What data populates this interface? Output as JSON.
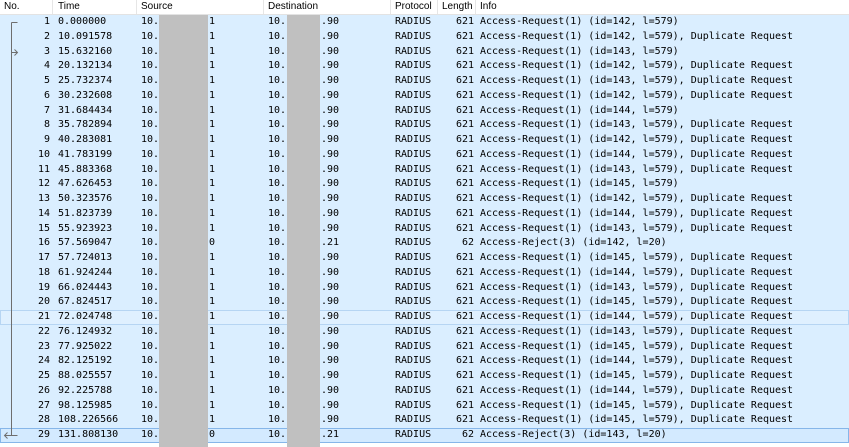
{
  "columns": {
    "no": "No.",
    "time": "Time",
    "source": "Source",
    "destination": "Destination",
    "protocol": "Protocol",
    "length": "Length",
    "info": "Info"
  },
  "colors": {
    "row_background": "#daeeff",
    "redaction": "#c0c0c0"
  },
  "packets": [
    {
      "no": 1,
      "time": "0.000000",
      "source_start": "10.",
      "source_end": "1",
      "destination_start": "10.",
      "destination_end": ".90",
      "protocol": "RADIUS",
      "length": 621,
      "info": "Access-Request(1) (id=142, l=579)",
      "marker": "conversation-start-icon"
    },
    {
      "no": 2,
      "time": "10.091578",
      "source_start": "10.",
      "source_end": "1",
      "destination_start": "10.",
      "destination_end": ".90",
      "protocol": "RADIUS",
      "length": 621,
      "info": "Access-Request(1) (id=142, l=579), Duplicate Request"
    },
    {
      "no": 3,
      "time": "15.632160",
      "source_start": "10.",
      "source_end": "1",
      "destination_start": "10.",
      "destination_end": ".90",
      "protocol": "RADIUS",
      "length": 621,
      "info": "Access-Request(1) (id=143, l=579)",
      "marker": "request-arrow-icon"
    },
    {
      "no": 4,
      "time": "20.132134",
      "source_start": "10.",
      "source_end": "1",
      "destination_start": "10.",
      "destination_end": ".90",
      "protocol": "RADIUS",
      "length": 621,
      "info": "Access-Request(1) (id=142, l=579), Duplicate Request"
    },
    {
      "no": 5,
      "time": "25.732374",
      "source_start": "10.",
      "source_end": "1",
      "destination_start": "10.",
      "destination_end": ".90",
      "protocol": "RADIUS",
      "length": 621,
      "info": "Access-Request(1) (id=143, l=579), Duplicate Request"
    },
    {
      "no": 6,
      "time": "30.232608",
      "source_start": "10.",
      "source_end": "1",
      "destination_start": "10.",
      "destination_end": ".90",
      "protocol": "RADIUS",
      "length": 621,
      "info": "Access-Request(1) (id=142, l=579), Duplicate Request"
    },
    {
      "no": 7,
      "time": "31.684434",
      "source_start": "10.",
      "source_end": "1",
      "destination_start": "10.",
      "destination_end": ".90",
      "protocol": "RADIUS",
      "length": 621,
      "info": "Access-Request(1) (id=144, l=579)"
    },
    {
      "no": 8,
      "time": "35.782894",
      "source_start": "10.",
      "source_end": "1",
      "destination_start": "10.",
      "destination_end": ".90",
      "protocol": "RADIUS",
      "length": 621,
      "info": "Access-Request(1) (id=143, l=579), Duplicate Request"
    },
    {
      "no": 9,
      "time": "40.283081",
      "source_start": "10.",
      "source_end": "1",
      "destination_start": "10.",
      "destination_end": ".90",
      "protocol": "RADIUS",
      "length": 621,
      "info": "Access-Request(1) (id=142, l=579), Duplicate Request"
    },
    {
      "no": 10,
      "time": "41.783199",
      "source_start": "10.",
      "source_end": "1",
      "destination_start": "10.",
      "destination_end": ".90",
      "protocol": "RADIUS",
      "length": 621,
      "info": "Access-Request(1) (id=144, l=579), Duplicate Request"
    },
    {
      "no": 11,
      "time": "45.883368",
      "source_start": "10.",
      "source_end": "1",
      "destination_start": "10.",
      "destination_end": ".90",
      "protocol": "RADIUS",
      "length": 621,
      "info": "Access-Request(1) (id=143, l=579), Duplicate Request"
    },
    {
      "no": 12,
      "time": "47.626453",
      "source_start": "10.",
      "source_end": "1",
      "destination_start": "10.",
      "destination_end": ".90",
      "protocol": "RADIUS",
      "length": 621,
      "info": "Access-Request(1) (id=145, l=579)"
    },
    {
      "no": 13,
      "time": "50.323576",
      "source_start": "10.",
      "source_end": "1",
      "destination_start": "10.",
      "destination_end": ".90",
      "protocol": "RADIUS",
      "length": 621,
      "info": "Access-Request(1) (id=142, l=579), Duplicate Request"
    },
    {
      "no": 14,
      "time": "51.823739",
      "source_start": "10.",
      "source_end": "1",
      "destination_start": "10.",
      "destination_end": ".90",
      "protocol": "RADIUS",
      "length": 621,
      "info": "Access-Request(1) (id=144, l=579), Duplicate Request"
    },
    {
      "no": 15,
      "time": "55.923923",
      "source_start": "10.",
      "source_end": "1",
      "destination_start": "10.",
      "destination_end": ".90",
      "protocol": "RADIUS",
      "length": 621,
      "info": "Access-Request(1) (id=143, l=579), Duplicate Request"
    },
    {
      "no": 16,
      "time": "57.569047",
      "source_start": "10.",
      "source_end": "0",
      "destination_start": "10.",
      "destination_end": ".21",
      "protocol": "RADIUS",
      "length": 62,
      "info": "Access-Reject(3) (id=142, l=20)"
    },
    {
      "no": 17,
      "time": "57.724013",
      "source_start": "10.",
      "source_end": "1",
      "destination_start": "10.",
      "destination_end": ".90",
      "protocol": "RADIUS",
      "length": 621,
      "info": "Access-Request(1) (id=145, l=579), Duplicate Request"
    },
    {
      "no": 18,
      "time": "61.924244",
      "source_start": "10.",
      "source_end": "1",
      "destination_start": "10.",
      "destination_end": ".90",
      "protocol": "RADIUS",
      "length": 621,
      "info": "Access-Request(1) (id=144, l=579), Duplicate Request"
    },
    {
      "no": 19,
      "time": "66.024443",
      "source_start": "10.",
      "source_end": "1",
      "destination_start": "10.",
      "destination_end": ".90",
      "protocol": "RADIUS",
      "length": 621,
      "info": "Access-Request(1) (id=143, l=579), Duplicate Request"
    },
    {
      "no": 20,
      "time": "67.824517",
      "source_start": "10.",
      "source_end": "1",
      "destination_start": "10.",
      "destination_end": ".90",
      "protocol": "RADIUS",
      "length": 621,
      "info": "Access-Request(1) (id=145, l=579), Duplicate Request"
    },
    {
      "no": 21,
      "time": "72.024748",
      "source_start": "10.",
      "source_end": "1",
      "destination_start": "10.",
      "destination_end": ".90",
      "protocol": "RADIUS",
      "length": 621,
      "info": "Access-Request(1) (id=144, l=579), Duplicate Request",
      "hovered": true
    },
    {
      "no": 22,
      "time": "76.124932",
      "source_start": "10.",
      "source_end": "1",
      "destination_start": "10.",
      "destination_end": ".90",
      "protocol": "RADIUS",
      "length": 621,
      "info": "Access-Request(1) (id=143, l=579), Duplicate Request"
    },
    {
      "no": 23,
      "time": "77.925022",
      "source_start": "10.",
      "source_end": "1",
      "destination_start": "10.",
      "destination_end": ".90",
      "protocol": "RADIUS",
      "length": 621,
      "info": "Access-Request(1) (id=145, l=579), Duplicate Request"
    },
    {
      "no": 24,
      "time": "82.125192",
      "source_start": "10.",
      "source_end": "1",
      "destination_start": "10.",
      "destination_end": ".90",
      "protocol": "RADIUS",
      "length": 621,
      "info": "Access-Request(1) (id=144, l=579), Duplicate Request"
    },
    {
      "no": 25,
      "time": "88.025557",
      "source_start": "10.",
      "source_end": "1",
      "destination_start": "10.",
      "destination_end": ".90",
      "protocol": "RADIUS",
      "length": 621,
      "info": "Access-Request(1) (id=145, l=579), Duplicate Request"
    },
    {
      "no": 26,
      "time": "92.225788",
      "source_start": "10.",
      "source_end": "1",
      "destination_start": "10.",
      "destination_end": ".90",
      "protocol": "RADIUS",
      "length": 621,
      "info": "Access-Request(1) (id=144, l=579), Duplicate Request"
    },
    {
      "no": 27,
      "time": "98.125985",
      "source_start": "10.",
      "source_end": "1",
      "destination_start": "10.",
      "destination_end": ".90",
      "protocol": "RADIUS",
      "length": 621,
      "info": "Access-Request(1) (id=145, l=579), Duplicate Request"
    },
    {
      "no": 28,
      "time": "108.226566",
      "source_start": "10.",
      "source_end": "1",
      "destination_start": "10.",
      "destination_end": ".90",
      "protocol": "RADIUS",
      "length": 621,
      "info": "Access-Request(1) (id=145, l=579), Duplicate Request"
    },
    {
      "no": 29,
      "time": "131.808130",
      "source_start": "10.",
      "source_end": "0",
      "destination_start": "10.",
      "destination_end": ".21",
      "protocol": "RADIUS",
      "length": 62,
      "info": "Access-Reject(3) (id=143, l=20)",
      "marker": "response-arrow-icon",
      "selected": true
    }
  ]
}
